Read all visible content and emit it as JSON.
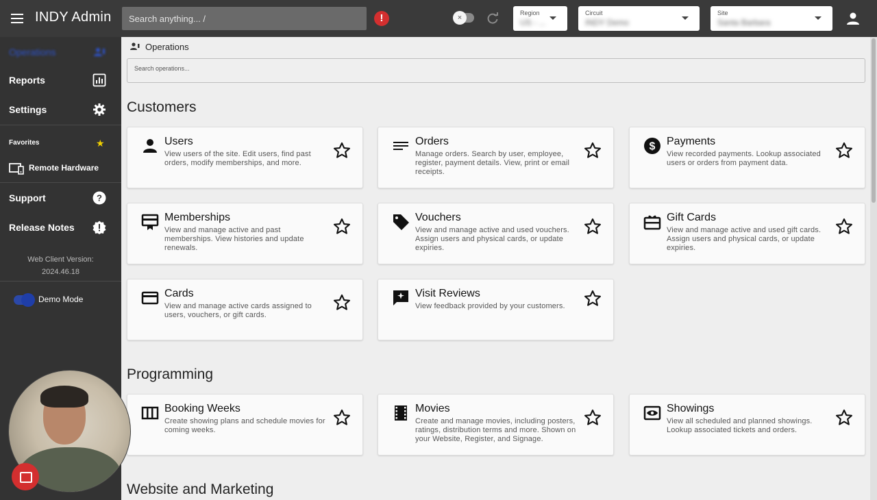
{
  "topbar": {
    "app_title": "INDY Admin",
    "search_placeholder": "Search anything... /",
    "alert_glyph": "!",
    "toggle_glyph": "×",
    "region": {
      "label": "Region",
      "value": "US - ..."
    },
    "circuit": {
      "label": "Circuit",
      "value": "INDY Demo"
    },
    "site": {
      "label": "Site",
      "value": "Santa Barbara"
    }
  },
  "sidebar": {
    "active_item": "Operations",
    "items": [
      {
        "label": "Reports",
        "icon": "bar-chart-icon"
      },
      {
        "label": "Settings",
        "icon": "gear-icon"
      }
    ],
    "favorites_label": "Favorites",
    "favorites_star": "★",
    "favorites": [
      {
        "label": "Remote Hardware",
        "icon": "monitor-icon"
      }
    ],
    "support_label": "Support",
    "release_notes_label": "Release Notes",
    "version_label": "Web Client Version:",
    "version_value": "2024.46.18",
    "demo_mode_label": "Demo Mode"
  },
  "main": {
    "breadcrumb": "Operations",
    "search_placeholder": "Search operations...",
    "sections": [
      {
        "title": "Customers"
      },
      {
        "title": "Programming"
      },
      {
        "title": "Website and Marketing"
      }
    ],
    "cards": {
      "users": {
        "title": "Users",
        "desc": "View users of the site. Edit users, find past orders, modify memberships, and more."
      },
      "orders": {
        "title": "Orders",
        "desc": "Manage orders. Search by user, employee, register, payment details. View, print or email receipts."
      },
      "payments": {
        "title": "Payments",
        "desc": "View recorded payments. Lookup associated users or orders from payment data."
      },
      "memberships": {
        "title": "Memberships",
        "desc": "View and manage active and past memberships. View histories and update renewals."
      },
      "vouchers": {
        "title": "Vouchers",
        "desc": "View and manage active and used vouchers. Assign users and physical cards, or update expiries."
      },
      "gift_cards": {
        "title": "Gift Cards",
        "desc": "View and manage active and used gift cards. Assign users and physical cards, or update expiries."
      },
      "cards": {
        "title": "Cards",
        "desc": "View and manage active cards assigned to users, vouchers, or gift cards."
      },
      "visit_reviews": {
        "title": "Visit Reviews",
        "desc": "View feedback provided by your customers."
      },
      "booking_weeks": {
        "title": "Booking Weeks",
        "desc": "Create showing plans and schedule movies for coming weeks."
      },
      "movies": {
        "title": "Movies",
        "desc": "Create and manage movies, including posters, ratings, distribution terms and more. Shown on your Website, Register, and Signage."
      },
      "showings": {
        "title": "Showings",
        "desc": "View all scheduled and planned showings. Lookup associated tickets and orders."
      }
    }
  },
  "colors": {
    "topbar_bg": "#3a3a3a",
    "sidebar_bg": "#333333",
    "alert_red": "#d32f2f",
    "active_blue": "#2d52c9",
    "favorite_star": "#f0d000"
  }
}
